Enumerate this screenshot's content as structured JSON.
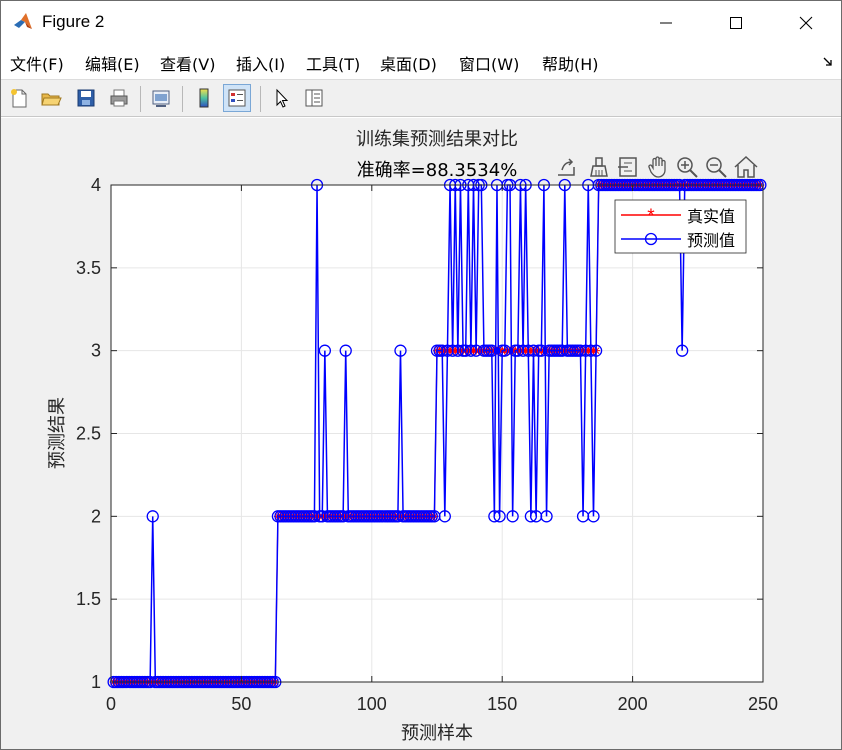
{
  "window": {
    "title": "Figure 2",
    "controls": {
      "minimize": "minimize-icon",
      "maximize": "maximize-icon",
      "close": "close-icon"
    }
  },
  "menu": {
    "items": [
      "文件(F)",
      "编辑(E)",
      "查看(V)",
      "插入(I)",
      "工具(T)",
      "桌面(D)",
      "窗口(W)",
      "帮助(H)"
    ]
  },
  "toolbar": {
    "buttons": [
      "new-figure-icon",
      "open-file-icon",
      "save-icon",
      "print-icon",
      "link-plot-icon",
      "colorbar-icon",
      "legend-icon",
      "pointer-icon",
      "property-inspector-icon"
    ]
  },
  "axes_toolbar": {
    "buttons": [
      "export-icon",
      "brush-icon",
      "datatip-icon",
      "pan-icon",
      "zoom-in-icon",
      "zoom-out-icon",
      "home-icon"
    ]
  },
  "colors": {
    "true_series": "#ff0000",
    "pred_series": "#0000ff",
    "grid": "#e6e6e6",
    "axes_bg": "#ffffff"
  },
  "chart_data": {
    "type": "line",
    "title": "训练集预测结果对比",
    "subtitle": "准确率=88.3534%",
    "xlabel": "预测样本",
    "ylabel": "预测结果",
    "xlim": [
      0,
      250
    ],
    "ylim": [
      1,
      4
    ],
    "xticks": [
      0,
      50,
      100,
      150,
      200,
      250
    ],
    "yticks": [
      1,
      1.5,
      2,
      2.5,
      3,
      3.5,
      4
    ],
    "xtick_labels": [
      "0",
      "50",
      "100",
      "150",
      "200",
      "250"
    ],
    "ytick_labels": [
      "1",
      "1.5",
      "2",
      "2.5",
      "3",
      "3.5",
      "4"
    ],
    "grid": true,
    "legend_position": "top-right",
    "legend": [
      "真实值",
      "预测值"
    ],
    "series": [
      {
        "name": "真实值",
        "marker": "star",
        "segments": [
          {
            "x_start": 1,
            "x_end": 63,
            "y": 1
          },
          {
            "x_start": 64,
            "x_end": 124,
            "y": 2
          },
          {
            "x_start": 125,
            "x_end": 186,
            "y": 3
          },
          {
            "x_start": 187,
            "x_end": 249,
            "y": 4
          }
        ]
      },
      {
        "name": "预测值",
        "marker": "circle",
        "deviations": [
          {
            "x": 16,
            "y": 2
          },
          {
            "x": 79,
            "y": 4
          },
          {
            "x": 82,
            "y": 3
          },
          {
            "x": 90,
            "y": 3
          },
          {
            "x": 111,
            "y": 3
          },
          {
            "x": 128,
            "y": 2
          },
          {
            "x": 130,
            "y": 4
          },
          {
            "x": 132,
            "y": 4
          },
          {
            "x": 134,
            "y": 4
          },
          {
            "x": 137,
            "y": 4
          },
          {
            "x": 139,
            "y": 4
          },
          {
            "x": 141,
            "y": 4
          },
          {
            "x": 142,
            "y": 4
          },
          {
            "x": 147,
            "y": 2
          },
          {
            "x": 148,
            "y": 4
          },
          {
            "x": 149,
            "y": 2
          },
          {
            "x": 152,
            "y": 4
          },
          {
            "x": 153,
            "y": 4
          },
          {
            "x": 154,
            "y": 2
          },
          {
            "x": 157,
            "y": 4
          },
          {
            "x": 159,
            "y": 4
          },
          {
            "x": 161,
            "y": 2
          },
          {
            "x": 163,
            "y": 2
          },
          {
            "x": 166,
            "y": 4
          },
          {
            "x": 167,
            "y": 2
          },
          {
            "x": 174,
            "y": 4
          },
          {
            "x": 181,
            "y": 2
          },
          {
            "x": 183,
            "y": 4
          },
          {
            "x": 185,
            "y": 2
          },
          {
            "x": 219,
            "y": 3
          }
        ]
      }
    ]
  }
}
